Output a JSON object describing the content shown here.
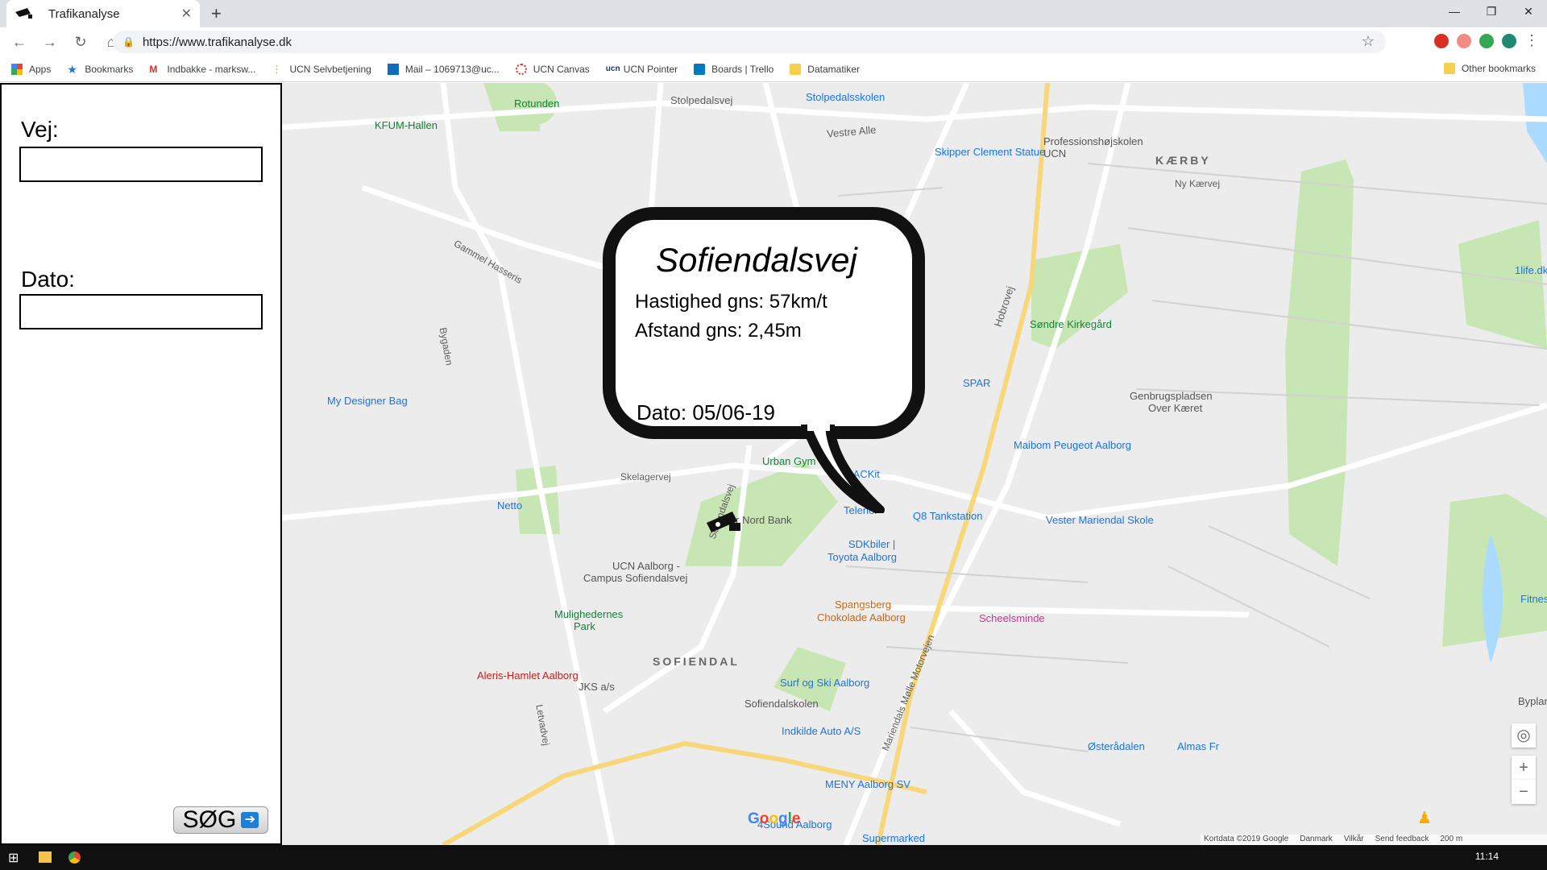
{
  "browser": {
    "tab_title": "Trafikanalyse",
    "url": "https://www.trafikanalyse.dk"
  },
  "bookmarks": [
    "Apps",
    "Bookmarks",
    "Indbakke - marksw...",
    "UCN Selvbetjening",
    "Mail – 1069713@uc...",
    "UCN Canvas",
    "UCN Pointer",
    "Boards | Trello",
    "Datamatiker"
  ],
  "bookmarks_other": "Other bookmarks",
  "form": {
    "vej_label": "Vej:",
    "vej_value": "",
    "dato_label": "Dato:",
    "dato_value": "",
    "search_label": "SØG"
  },
  "bubble": {
    "title": "Sofiendalsvej",
    "speed": "Hastighed gns: 57km/t",
    "distance": "Afstand gns: 2,45m",
    "date": "Dato: 05/06-19"
  },
  "map_labels": {
    "streets": [
      "Stolpedalsvej",
      "Vestre Alle",
      "Skelagervej",
      "Sofiendalsvej",
      "Hobrovej",
      "Bygaden",
      "Letvadvej",
      "Gammel Hasseris",
      "Mariendals Mølle Motorvejen",
      "Ny Kærvej"
    ],
    "pois": {
      "stolpedal": "Stolpedalsskolen",
      "skipper": "Skipper Clement Statue",
      "prof": "Professionshøjskolen",
      "ucn": "UCN",
      "kfum": "KFUM-Hallen",
      "rotunden": "Rotunden",
      "kirke": "Søndre Kirkegård",
      "spar": "SPAR",
      "designer": "My Designer Bag",
      "netto": "Netto",
      "urban": "Urban Gym",
      "sackit": "SACKit",
      "sparnord": "Spar Nord Bank",
      "telenor": "Telenor",
      "q8": "Q8 Tankstation",
      "maibom": "Maibom Peugeot Aalborg",
      "vester": "Vester Mariendal Skole",
      "sdk1": "SDKbiler |",
      "sdk2": "Toyota Aalborg",
      "ucn_a1": "UCN Aalborg -",
      "ucn_a2": "Campus Sofiendalsvej",
      "park1": "Mulighedernes",
      "park2": "Park",
      "spangs1": "Spangsberg",
      "spangs2": "Chokolade Aalborg",
      "scheel": "Scheelsminde",
      "aleris": "Aleris-Hamlet Aalborg",
      "jks": "JKS a/s",
      "surf": "Surf og Ski Aalborg",
      "sofskole": "Sofiendalskolen",
      "indkilde": "Indkilde Auto A/S",
      "meny": "MENY Aalborg SV",
      "foursound": "4Sound Aalborg",
      "super": "Supermarked",
      "genbrug1": "Genbrugspladsen",
      "genbrug2": "Over Kæret",
      "oster": "Østerådalen",
      "almas": "Almas Fr",
      "fitness": "Fitnes",
      "life": "1life.dk",
      "byplan": "Byplan"
    },
    "areas": [
      "SOFIENDAL",
      "KÆRBY"
    ]
  },
  "map_footer": [
    "Kortdata ©2019 Google",
    "Danmark",
    "Vilkår",
    "Send feedback",
    "200 m"
  ],
  "taskbar_time": "11:14"
}
